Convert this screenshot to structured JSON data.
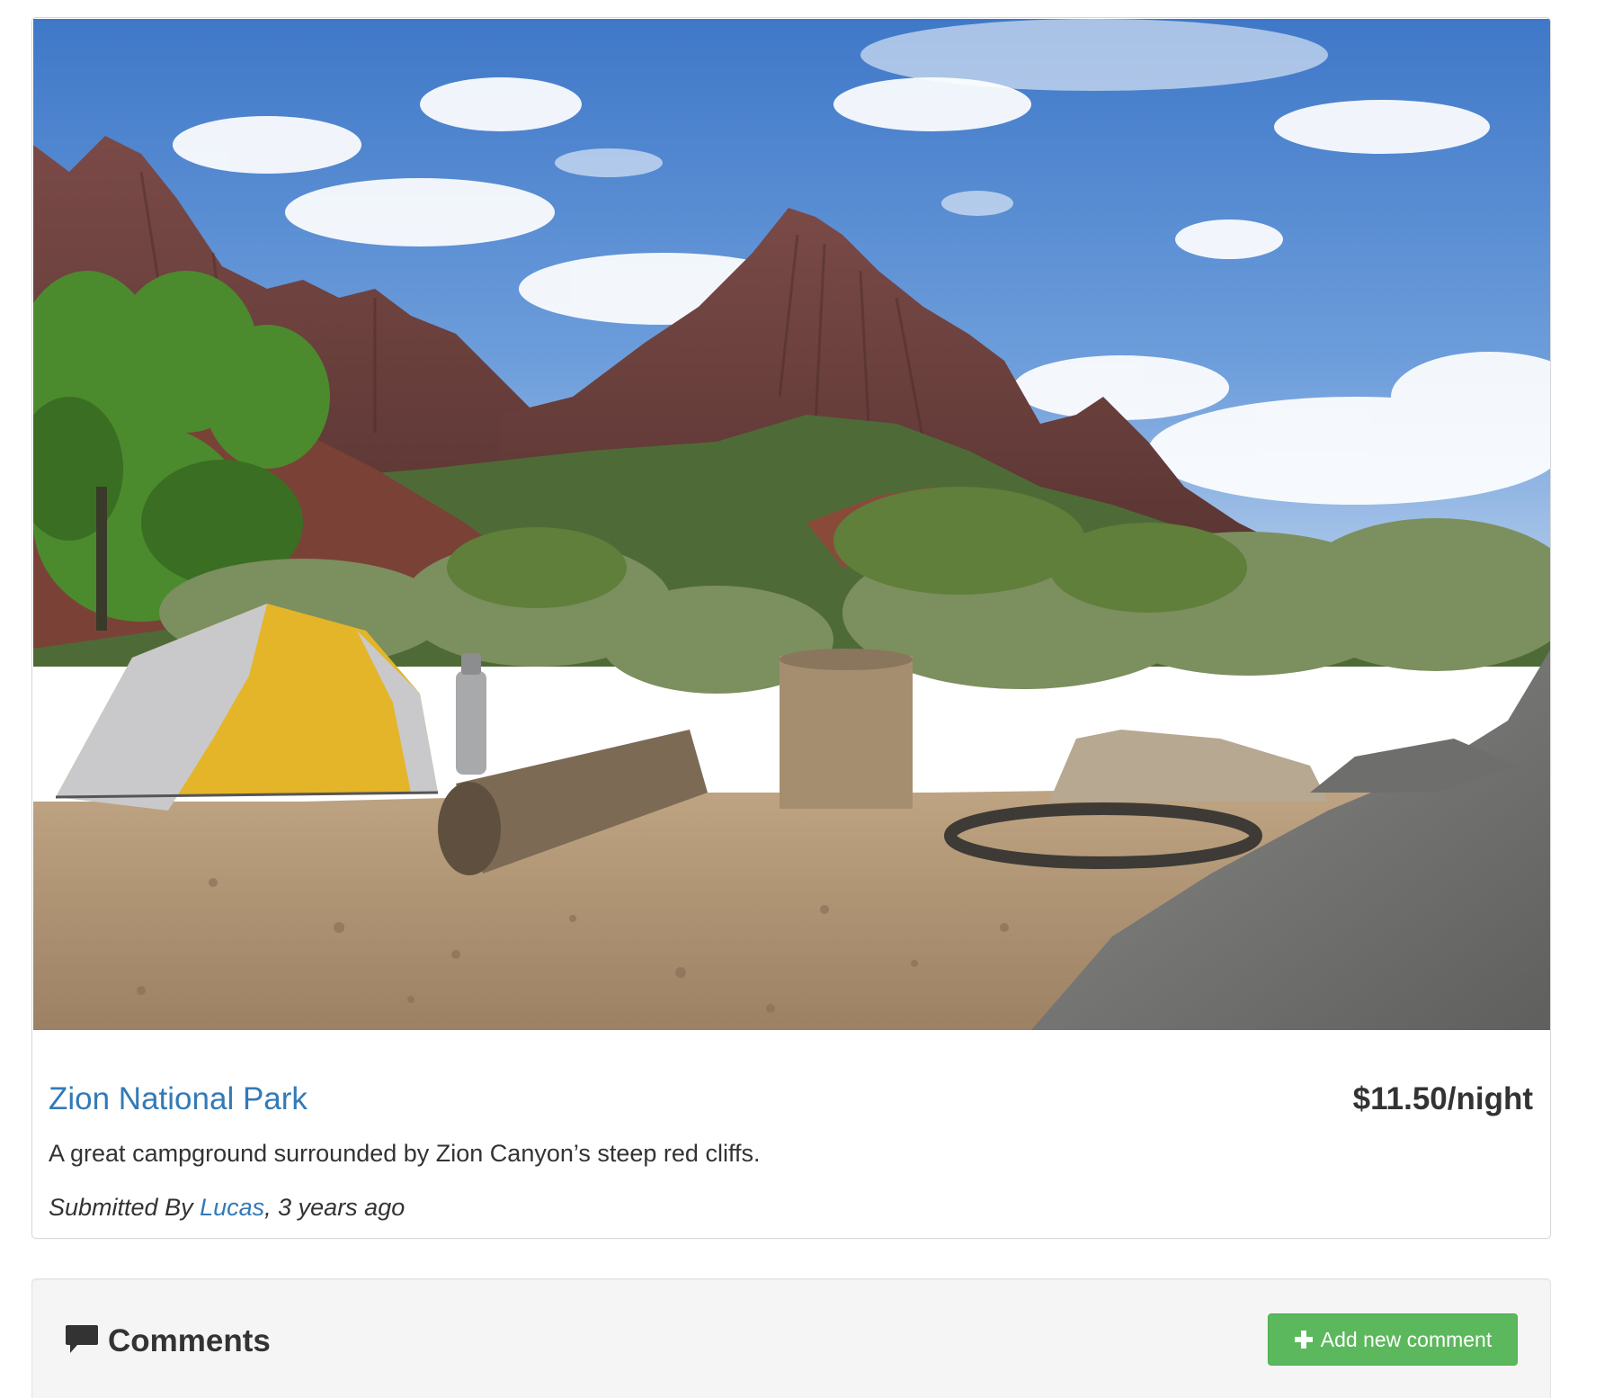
{
  "campground": {
    "name": "Zion National Park",
    "price": "$11.50/night",
    "description": "A great campground surrounded by Zion Canyon’s steep red cliffs.",
    "submitted_prefix": "Submitted By ",
    "author": "Lucas",
    "submitted_suffix": ", 3 years ago",
    "image_alt": "Campsite with a yellow tent, logs and fire ring below a red rock mountain peak"
  },
  "comments": {
    "heading": "Comments",
    "add_button_label": "Add new comment",
    "icons": {
      "heading_icon": "comment-icon",
      "button_icon": "plus-icon"
    }
  },
  "colors": {
    "link": "#337ab7",
    "button_success": "#5cb85c",
    "well_background": "#f5f5f5",
    "text": "#333333"
  }
}
